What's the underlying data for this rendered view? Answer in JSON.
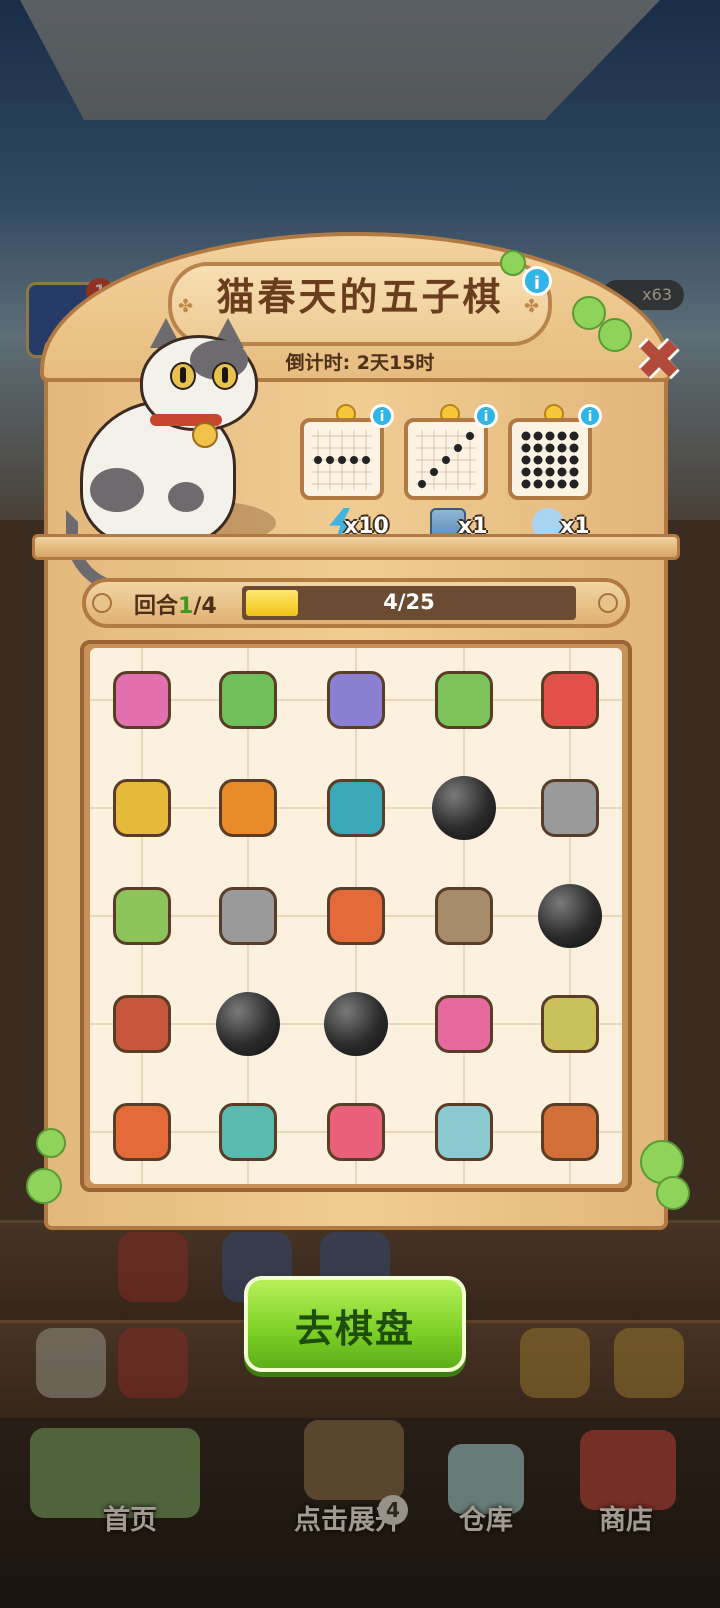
{
  "event": {
    "title": "猫春天的五子棋",
    "countdown": "倒计时: 2天15时"
  },
  "patterns": [
    {
      "name": "horizontal-line",
      "reward_icon": "lightning-energy-icon",
      "reward_text": "x10"
    },
    {
      "name": "diagonal-line",
      "reward_icon": "dice-box-icon",
      "reward_text": "x1"
    },
    {
      "name": "full-grid",
      "reward_icon": "blue-bird-icon",
      "reward_text": "x1"
    }
  ],
  "progress": {
    "round_prefix": "回合",
    "round_current": "1",
    "round_total": "/4",
    "count_text": "4/25",
    "fraction": 0.16
  },
  "board": {
    "rows": [
      [
        "pink-bucket-icon",
        "potted-berry-plant-icon",
        "crystal-plant-icon",
        "seedling-pot-icon",
        "watermelon-juice-icon"
      ],
      [
        "skewer-icon",
        "detergent-bottle-icon",
        "blue-fish-icon",
        "black-stone",
        "axe-icon"
      ],
      [
        "vegetable-skewer-icon",
        "axe-icon",
        "teapot-icon",
        "hoe-icon",
        "black-stone"
      ],
      [
        "bbq-skewer-tray-icon",
        "black-stone",
        "black-stone",
        "mop-icon",
        "paint-buckets-icon"
      ],
      [
        "teapot-icon",
        "towel-icon",
        "starfish-icon",
        "apron-icon",
        "broom-icon"
      ]
    ]
  },
  "go_button": "去棋盘",
  "side": {
    "left_badge": "1",
    "right_counter": "x63"
  },
  "nav": {
    "home": "首页",
    "expand": "点击展开",
    "expand_badge": "4",
    "warehouse": "仓库",
    "shop": "商店"
  },
  "colors": {
    "accent_green": "#7bcf25",
    "wood": "#e7bc80",
    "close_red": "#b24a3c",
    "info_blue": "#2fb5e8"
  }
}
